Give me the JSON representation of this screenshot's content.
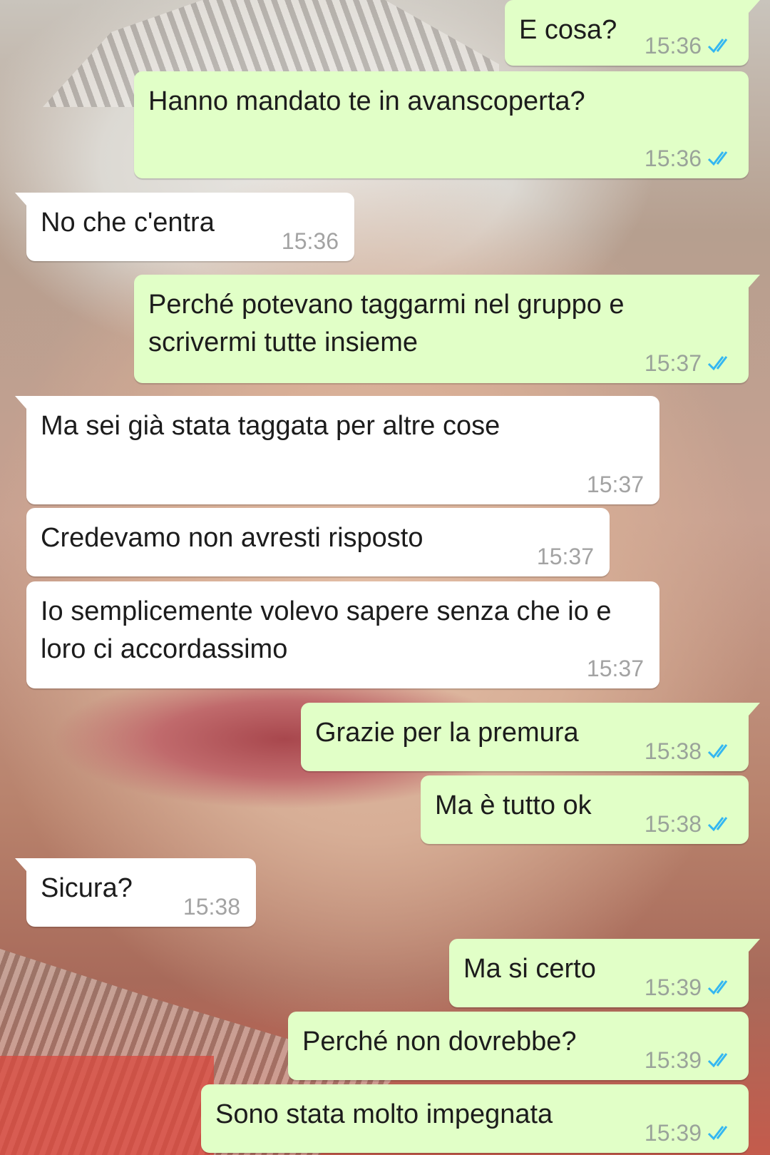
{
  "messages": [
    {
      "dir": "out",
      "text": "E cosa?",
      "time": "15:36",
      "status": "read"
    },
    {
      "dir": "out",
      "text": "Hanno mandato te in avanscoperta?",
      "time": "15:36",
      "status": "read"
    },
    {
      "dir": "in",
      "text": "No che c'entra",
      "time": "15:36"
    },
    {
      "dir": "out",
      "text": "Perché potevano taggarmi nel gruppo e scrivermi tutte insieme",
      "time": "15:37",
      "status": "read"
    },
    {
      "dir": "in",
      "text": "Ma sei già stata taggata per altre cose",
      "time": "15:37"
    },
    {
      "dir": "in",
      "text": "Credevamo non avresti risposto",
      "time": "15:37"
    },
    {
      "dir": "in",
      "text": "Io semplicemente volevo sapere senza che io e loro ci accordassimo",
      "time": "15:37"
    },
    {
      "dir": "out",
      "text": "Grazie per la premura",
      "time": "15:38",
      "status": "read"
    },
    {
      "dir": "out",
      "text": "Ma è tutto ok",
      "time": "15:38",
      "status": "read"
    },
    {
      "dir": "in",
      "text": "Sicura?",
      "time": "15:38"
    },
    {
      "dir": "out",
      "text": "Ma si certo",
      "time": "15:39",
      "status": "read"
    },
    {
      "dir": "out",
      "text": "Perché non dovrebbe?",
      "time": "15:39",
      "status": "read"
    },
    {
      "dir": "out",
      "text": "Sono stata molto impegnata",
      "time": "15:39",
      "status": "read"
    }
  ],
  "colors": {
    "outgoing_bubble": "#e1ffc7",
    "incoming_bubble": "#ffffff",
    "read_ticks": "#34b7f1"
  },
  "icons": {
    "read_status": "double-check-icon"
  }
}
